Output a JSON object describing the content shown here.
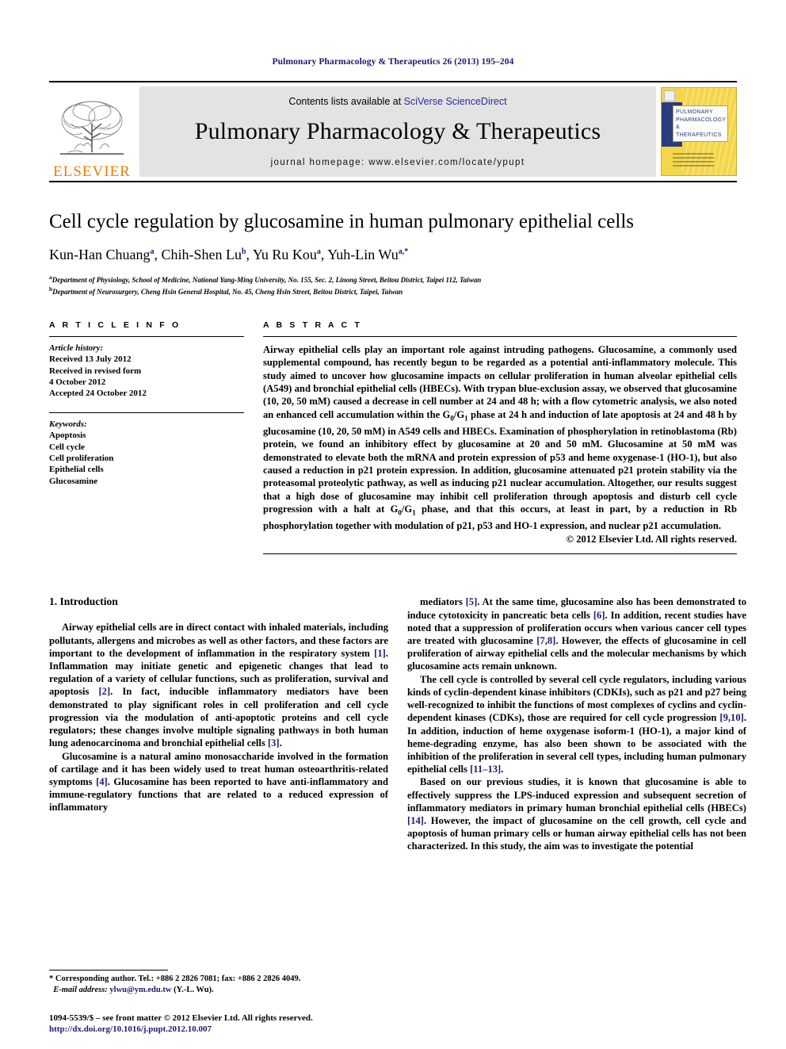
{
  "running_head": "Pulmonary Pharmacology & Therapeutics 26 (2013) 195–204",
  "masthead": {
    "publisher_wordmark": "ELSEVIER",
    "contents_prefix": "Contents lists available at ",
    "contents_link": "SciVerse ScienceDirect",
    "journal_title": "Pulmonary Pharmacology & Therapeutics",
    "homepage": "journal homepage: www.elsevier.com/locate/ypupt",
    "cover": {
      "line1": "PULMONARY",
      "line2": "PHARMACOLOGY",
      "line3": "& THERAPEUTICS"
    }
  },
  "article": {
    "title": "Cell cycle regulation by glucosamine in human pulmonary epithelial cells",
    "authors_html": "Kun-Han Chuang a, Chih-Shen Lu b, Yu Ru Kou a, Yuh-Lin Wu a,*",
    "authors": [
      {
        "name": "Kun-Han Chuang",
        "marks": "a"
      },
      {
        "name": "Chih-Shen Lu",
        "marks": "b"
      },
      {
        "name": "Yu Ru Kou",
        "marks": "a"
      },
      {
        "name": "Yuh-Lin Wu",
        "marks": "a,*"
      }
    ],
    "affiliations": [
      {
        "mark": "a",
        "text": "Department of Physiology, School of Medicine, National Yang-Ming University, No. 155, Sec. 2, Linong Street, Beitou District, Taipei 112, Taiwan"
      },
      {
        "mark": "b",
        "text": "Department of Neurosurgery, Cheng Hsin General Hospital, No. 45, Cheng Hsin Street, Beitou District, Taipei, Taiwan"
      }
    ]
  },
  "article_info": {
    "heading": "A R T I C L E   I N F O",
    "history_label": "Article history:",
    "history": [
      "Received 13 July 2012",
      "Received in revised form",
      "4 October 2012",
      "Accepted 24 October 2012"
    ],
    "keywords_label": "Keywords:",
    "keywords": [
      "Apoptosis",
      "Cell cycle",
      "Cell proliferation",
      "Epithelial cells",
      "Glucosamine"
    ]
  },
  "abstract": {
    "heading": "A B S T R A C T",
    "part1": "Airway epithelial cells play an important role against intruding pathogens. Glucosamine, a commonly used supplemental compound, has recently begun to be regarded as a potential anti-inflammatory molecule. This study aimed to uncover how glucosamine impacts on cellular proliferation in human alveolar epithelial cells (A549) and bronchial epithelial cells (HBECs). With trypan blue-exclusion assay, we observed that glucosamine (10, 20, 50 mM) caused a decrease in cell number at 24 and 48 h; with a flow cytometric analysis, we also noted an enhanced cell accumulation within the G",
    "sub1": "0",
    "mid1": "/G",
    "sub2": "1",
    "part2": " phase at 24 h and induction of late apoptosis at 24 and 48 h by glucosamine (10, 20, 50 mM) in A549 cells and HBECs. Examination of phosphorylation in retinoblastoma (Rb) protein, we found an inhibitory effect by glucosamine at 20 and 50 mM. Glucosamine at 50 mM was demonstrated to elevate both the mRNA and protein expression of p53 and heme oxygenase-1 (HO-1), but also caused a reduction in p21 protein expression. In addition, glucosamine attenuated p21 protein stability via the proteasomal proteolytic pathway, as well as inducing p21 nuclear accumulation. Altogether, our results suggest that a high dose of glucosamine may inhibit cell proliferation through apoptosis and disturb cell cycle progression with a halt at G",
    "sub3": "0",
    "mid2": "/G",
    "sub4": "1",
    "part3": " phase, and that this occurs, at least in part, by a reduction in Rb phosphorylation together with modulation of p21, p53 and HO-1 expression, and nuclear p21 accumulation.",
    "copyright": "© 2012 Elsevier Ltd. All rights reserved."
  },
  "introduction": {
    "section_number_title": "1. Introduction",
    "left_paragraphs": [
      {
        "segments": [
          {
            "t": "Airway epithelial cells are in direct contact with inhaled materials, including pollutants, allergens and microbes as well as other factors, and these factors are important to the development of inflammation in the respiratory system "
          },
          {
            "t": "[1]",
            "ref": true
          },
          {
            "t": ". Inflammation may initiate genetic and epigenetic changes that lead to regulation of a variety of cellular functions, such as proliferation, survival and apoptosis "
          },
          {
            "t": "[2]",
            "ref": true
          },
          {
            "t": ". In fact, inducible inflammatory mediators have been demonstrated to play significant roles in cell proliferation and cell cycle progression via the modulation of anti-apoptotic proteins and cell cycle regulators; these changes involve multiple signaling pathways in both human lung adenocarcinoma and bronchial epithelial cells "
          },
          {
            "t": "[3]",
            "ref": true
          },
          {
            "t": "."
          }
        ]
      },
      {
        "segments": [
          {
            "t": "Glucosamine is a natural amino monosaccharide involved in the formation of cartilage and it has been widely used to treat human osteoarthritis-related symptoms "
          },
          {
            "t": "[4]",
            "ref": true
          },
          {
            "t": ". Glucosamine has been reported to have anti-inflammatory and immune-regulatory functions that are related to a reduced expression of inflammatory"
          }
        ]
      }
    ],
    "right_paragraphs": [
      {
        "segments": [
          {
            "t": "mediators "
          },
          {
            "t": "[5]",
            "ref": true
          },
          {
            "t": ". At the same time, glucosamine also has been demonstrated to induce cytotoxicity in pancreatic beta cells "
          },
          {
            "t": "[6]",
            "ref": true
          },
          {
            "t": ". In addition, recent studies have noted that a suppression of proliferation occurs when various cancer cell types are treated with glucosamine "
          },
          {
            "t": "[7,8]",
            "ref": true
          },
          {
            "t": ". However, the effects of glucosamine in cell proliferation of airway epithelial cells and the molecular mechanisms by which glucosamine acts remain unknown."
          }
        ],
        "no_indent": true
      },
      {
        "segments": [
          {
            "t": "The cell cycle is controlled by several cell cycle regulators, including various kinds of cyclin-dependent kinase inhibitors (CDKIs), such as p21 and p27 being well-recognized to inhibit the functions of most complexes of cyclins and cyclin-dependent kinases (CDKs), those are required for cell cycle progression "
          },
          {
            "t": "[9,10]",
            "ref": true
          },
          {
            "t": ". In addition, induction of heme oxygenase isoform-1 (HO-1), a major kind of heme-degrading enzyme, has also been shown to be associated with the inhibition of the proliferation in several cell types, including human pulmonary epithelial cells "
          },
          {
            "t": "[11–13]",
            "ref": true
          },
          {
            "t": "."
          }
        ]
      },
      {
        "segments": [
          {
            "t": "Based on our previous studies, it is known that glucosamine is able to effectively suppress the LPS-induced expression and subsequent secretion of inflammatory mediators in primary human bronchial epithelial cells (HBECs) "
          },
          {
            "t": "[14]",
            "ref": true
          },
          {
            "t": ". However, the impact of glucosamine on the cell growth, cell cycle and apoptosis of human primary cells or human airway epithelial cells has not been characterized. In this study, the aim was to investigate the potential"
          }
        ]
      }
    ]
  },
  "footnotes": {
    "corresponding": "* Corresponding author. Tel.: +886 2 2826 7081; fax: +886 2 2826 4049.",
    "email_label": "E-mail address:",
    "email": "ylwu@ym.edu.tw",
    "email_suffix": "(Y.-L. Wu).",
    "issn_line": "1094-5539/$ – see front matter © 2012 Elsevier Ltd. All rights reserved.",
    "doi": "http://dx.doi.org/10.1016/j.pupt.2012.10.007"
  },
  "colors": {
    "link_blue": "#2b2b9e",
    "ref_blue": "#1a1a6e",
    "elsevier_orange": "#f07d00",
    "masthead_grey": "#e3e3e3",
    "cover_yellow": "#f5d64a",
    "cover_navy": "#2a3c80"
  }
}
